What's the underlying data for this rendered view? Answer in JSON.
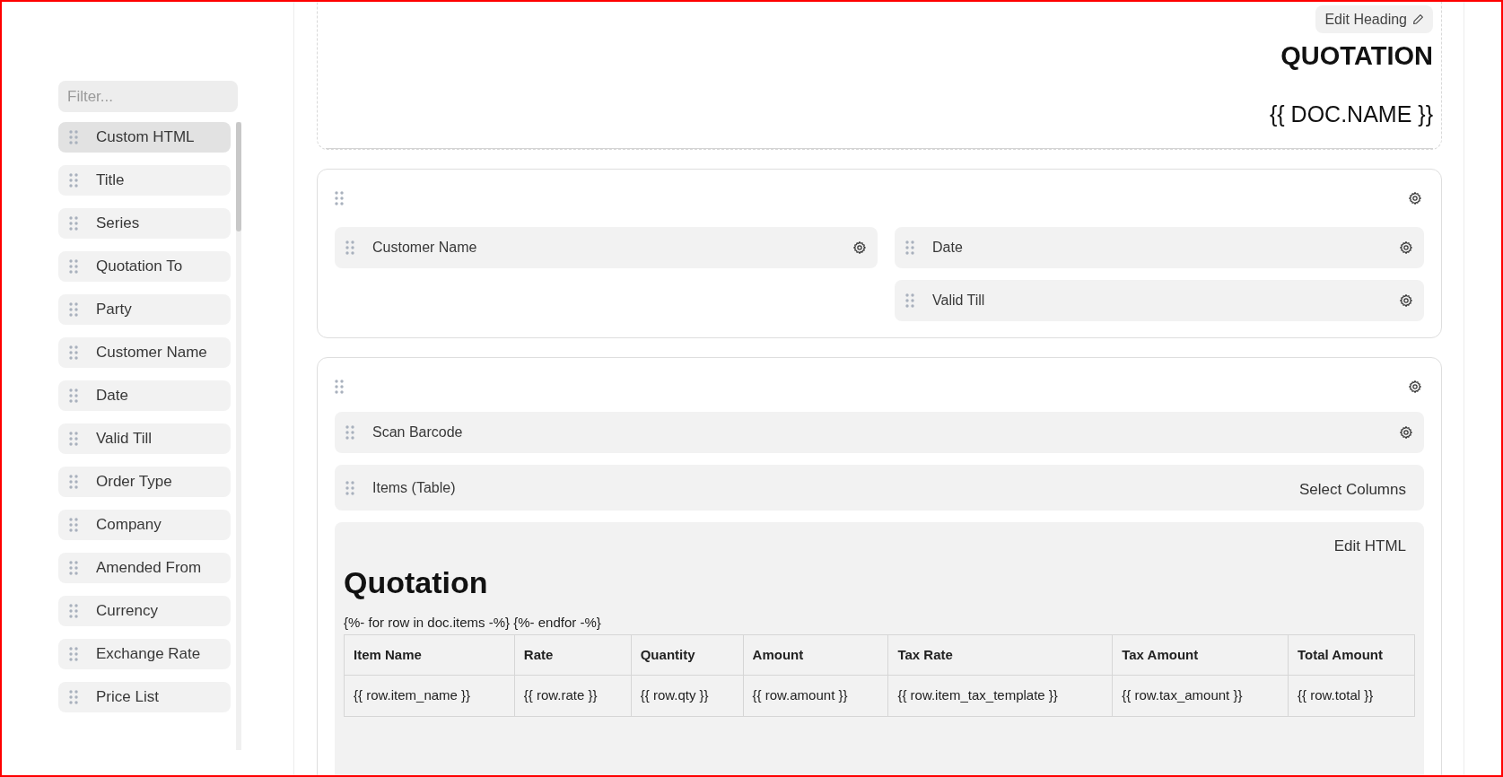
{
  "sidebar": {
    "filter": {
      "placeholder": "Filter..."
    },
    "items": [
      {
        "label": "Custom HTML",
        "selected": true
      },
      {
        "label": "Title",
        "selected": false
      },
      {
        "label": "Series",
        "selected": false
      },
      {
        "label": "Quotation To",
        "selected": false
      },
      {
        "label": "Party",
        "selected": false
      },
      {
        "label": "Customer Name",
        "selected": false
      },
      {
        "label": "Date",
        "selected": false
      },
      {
        "label": "Valid Till",
        "selected": false
      },
      {
        "label": "Order Type",
        "selected": false
      },
      {
        "label": "Company",
        "selected": false
      },
      {
        "label": "Amended From",
        "selected": false
      },
      {
        "label": "Currency",
        "selected": false
      },
      {
        "label": "Exchange Rate",
        "selected": false
      },
      {
        "label": "Price List",
        "selected": false
      }
    ]
  },
  "heading": {
    "edit_button": "Edit Heading",
    "title": "QUOTATION",
    "subtitle": "{{ DOC.NAME }}"
  },
  "section_1": {
    "left_fields": [
      "Customer Name"
    ],
    "right_fields": [
      "Date",
      "Valid Till"
    ]
  },
  "section_2": {
    "fields": [
      "Scan Barcode"
    ],
    "table_field": {
      "label": "Items (Table)",
      "action": "Select Columns"
    },
    "custom_html": {
      "action": "Edit HTML",
      "heading": "Quotation",
      "loop_text": "{%- for row in doc.items -%} {%- endfor -%}",
      "columns": [
        "Item Name",
        "Rate",
        "Quantity",
        "Amount",
        "Tax Rate",
        "Tax Amount",
        "Total Amount"
      ],
      "row": [
        "{{ row.item_name }}",
        "{{ row.rate }}",
        "{{ row.qty }}",
        "{{ row.amount }}",
        "{{ row.item_tax_template }}",
        "{{ row.tax_amount }}",
        "{{ row.total }}"
      ]
    }
  }
}
